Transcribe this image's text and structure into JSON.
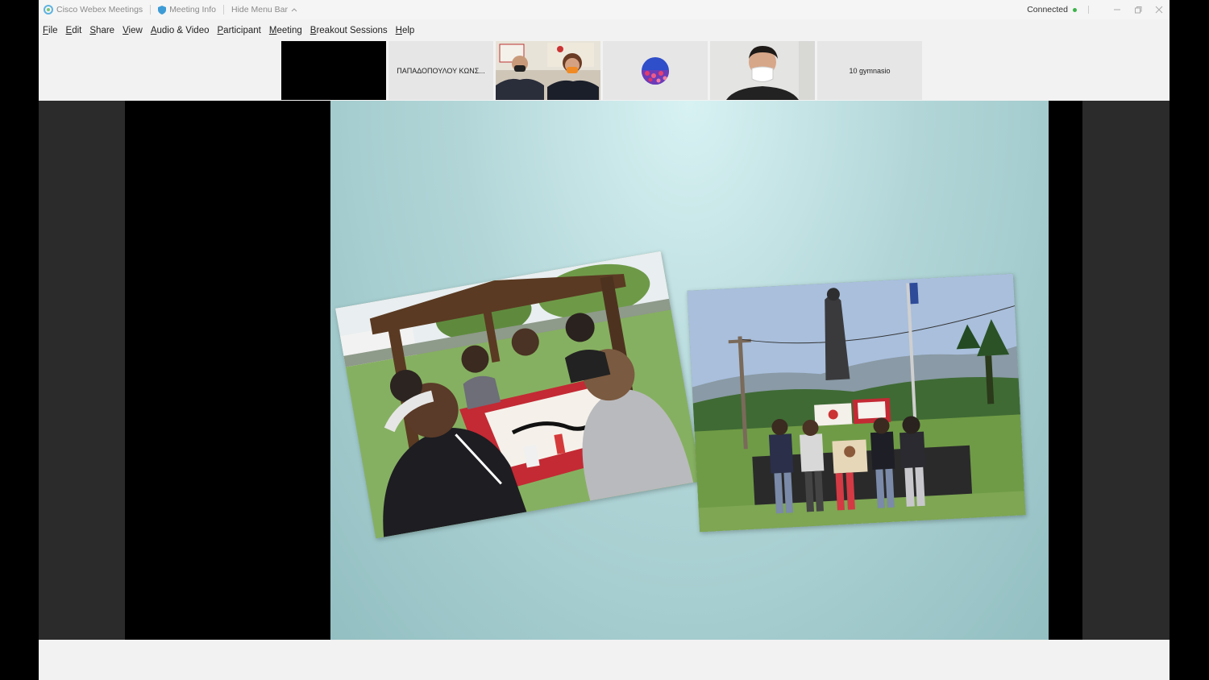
{
  "titlebar": {
    "app_name": "Cisco Webex Meetings",
    "meeting_info": "Meeting Info",
    "hide_menu_bar": "Hide Menu Bar",
    "status": "Connected"
  },
  "menu": {
    "items": [
      {
        "accel": "F",
        "rest": "ile"
      },
      {
        "accel": "E",
        "rest": "dit"
      },
      {
        "accel": "S",
        "rest": "hare"
      },
      {
        "accel": "V",
        "rest": "iew"
      },
      {
        "accel": "A",
        "rest": "udio & Video"
      },
      {
        "accel": "P",
        "rest": "articipant"
      },
      {
        "accel": "M",
        "rest": "eeting"
      },
      {
        "accel": "B",
        "rest": "reakout Sessions"
      },
      {
        "accel": "H",
        "rest": "elp"
      }
    ]
  },
  "participants": [
    {
      "name": "",
      "type": "video-off"
    },
    {
      "name": "ΠΑΠΑΔΟΠΟΥΛΟΥ ΚΩΝΣ...",
      "type": "name"
    },
    {
      "name": "",
      "type": "video-two-people"
    },
    {
      "name": "",
      "type": "avatar"
    },
    {
      "name": "",
      "type": "video-one-person"
    },
    {
      "name": "10 gymnasio",
      "type": "name"
    }
  ],
  "colors": {
    "connected": "#3bb34a",
    "slide_bg": "#a9d1d3",
    "webex_blue": "#3d9bd6"
  },
  "icons": [
    "webex-logo-icon",
    "shield-icon",
    "chevron-up-icon",
    "minimize-icon",
    "restore-icon",
    "close-icon"
  ]
}
